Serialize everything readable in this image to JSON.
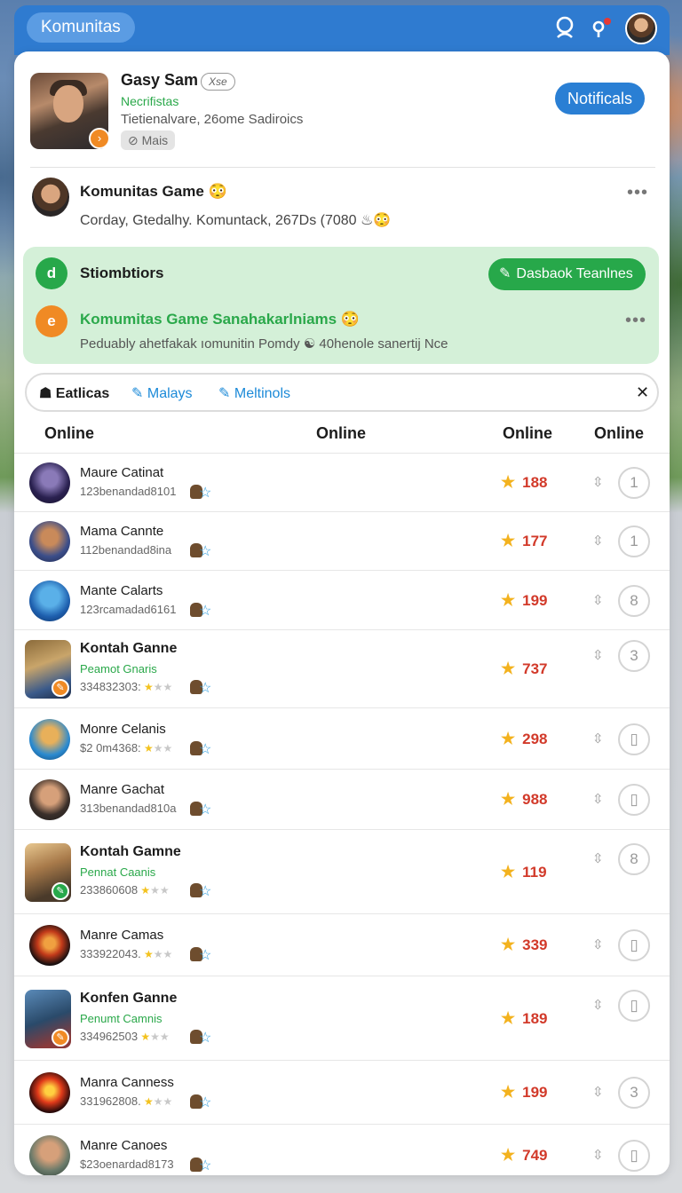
{
  "app": {
    "title": "Komunitas"
  },
  "profile": {
    "name": "Gasy Sam",
    "tag": "Xse",
    "subtitle": "Necrifistas",
    "meta": "Tietienalvare, 26ome Sadiroics",
    "mais_label": "⊘ Mais",
    "notif_button": "Notificals"
  },
  "post": {
    "title": "Komunitas Game 😳",
    "text": "Corday, Gtedalhy. Komuntack, 267Ds (7080 ♨😳"
  },
  "green_panel": {
    "icon1": "d",
    "title": "Stiombtiors",
    "button": "Dasbaok Teanlnes",
    "icon2": "e",
    "sub_title": "Komumitas Game Sanahakarlniams 😳",
    "sub_text": "Peduably ahetfakak ıomunitin Pomdy ☯ 40henole sanertij Nce"
  },
  "filters": {
    "first": "Eatlicas",
    "second": "Malays",
    "third": "Meltinols"
  },
  "columns": [
    "Online",
    "Online",
    "Online",
    "Online"
  ],
  "rows": [
    {
      "name": "Maure Catinat",
      "meta": "123benandad8101",
      "score": "188",
      "circle": "1",
      "style": "plain"
    },
    {
      "name": "Mama Cannte",
      "meta": "112benandad8ina",
      "score": "177",
      "circle": "1",
      "style": "plain"
    },
    {
      "name": "Mante Calarts",
      "meta": "123rcamadad6161",
      "score": "199",
      "circle": "8",
      "style": "plain"
    },
    {
      "name": "Kontah Ganne",
      "sub": "Peamot Gnaris",
      "meta": "334832303:",
      "score": "737",
      "circle": "3",
      "style": "featured"
    },
    {
      "name": "Monre Celanis",
      "meta": "$2 0m4368:",
      "score": "298",
      "circle": "▯",
      "style": "rated"
    },
    {
      "name": "Manre Gachat",
      "meta": "313benandad810a",
      "score": "988",
      "circle": "▯",
      "style": "plain"
    },
    {
      "name": "Kontah Gamne",
      "sub": "Pennat Caanis",
      "meta": "233860608",
      "score": "119",
      "circle": "8",
      "style": "featured"
    },
    {
      "name": "Manre Camas",
      "meta": "333922043.",
      "score": "339",
      "circle": "▯",
      "style": "rated"
    },
    {
      "name": "Konfen Ganne",
      "sub": "Penumt Camnis",
      "meta": "334962503",
      "score": "189",
      "circle": "▯",
      "style": "featured"
    },
    {
      "name": "Manra Canness",
      "meta": "331962808.",
      "score": "199",
      "circle": "3",
      "style": "rated"
    },
    {
      "name": "Manre Canoes",
      "meta": "$23oenardad8173",
      "score": "749",
      "circle": "▯",
      "style": "plain"
    }
  ],
  "colors": {
    "accent": "#2a7fd4",
    "green": "#27a84a",
    "score": "#d23a2a",
    "badge_orange": "#f08a24"
  }
}
